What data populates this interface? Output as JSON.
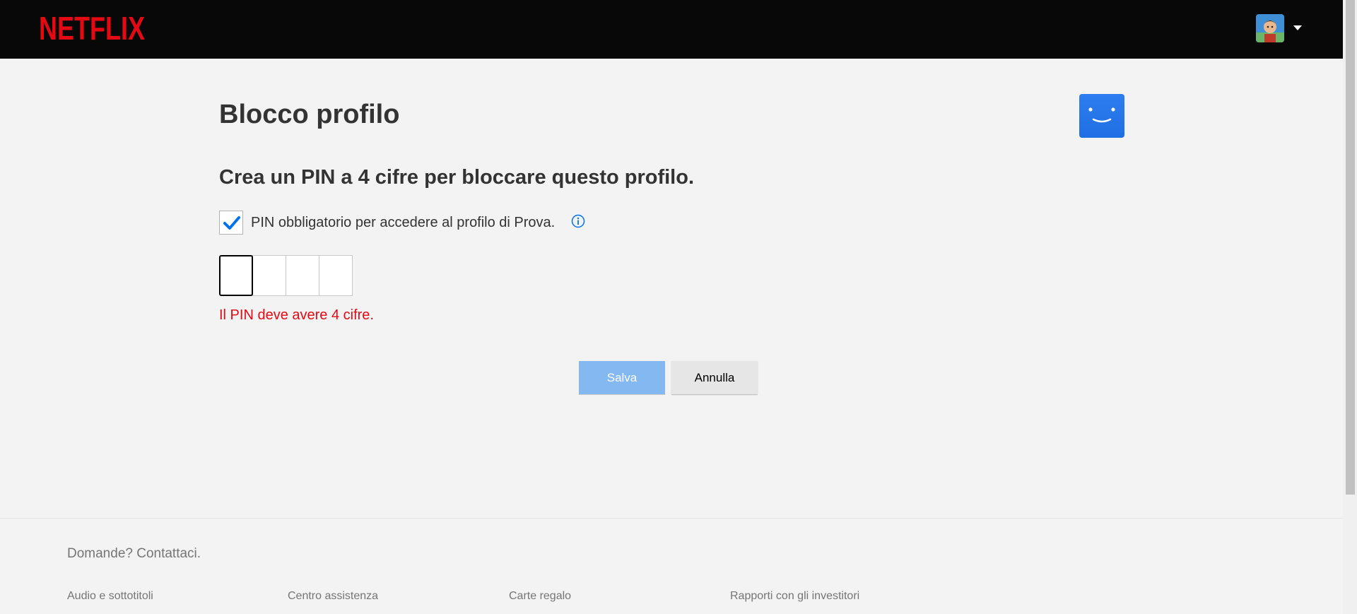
{
  "brand": {
    "logo_text": "NETFLIX",
    "logo_color": "#e50914",
    "profile_blue": "#2e7df0"
  },
  "header": {
    "avatar_icon": "profile-avatar-icon",
    "menu_icon": "caret-down-icon"
  },
  "main": {
    "title": "Blocco profilo",
    "subtitle": "Crea un PIN a 4 cifre per bloccare questo profilo.",
    "checkbox": {
      "label": "PIN obbligatorio per accedere al profilo di Prova.",
      "checked": true
    },
    "pin": {
      "digits": [
        "",
        "",
        "",
        ""
      ]
    },
    "error": "Il PIN deve avere 4 cifre.",
    "save_label": "Salva",
    "cancel_label": "Annulla"
  },
  "footer": {
    "contact": "Domande? Contattaci.",
    "links": [
      "Audio e sottotitoli",
      "Centro assistenza",
      "Carte regalo",
      "Rapporti con gli investitori"
    ]
  }
}
